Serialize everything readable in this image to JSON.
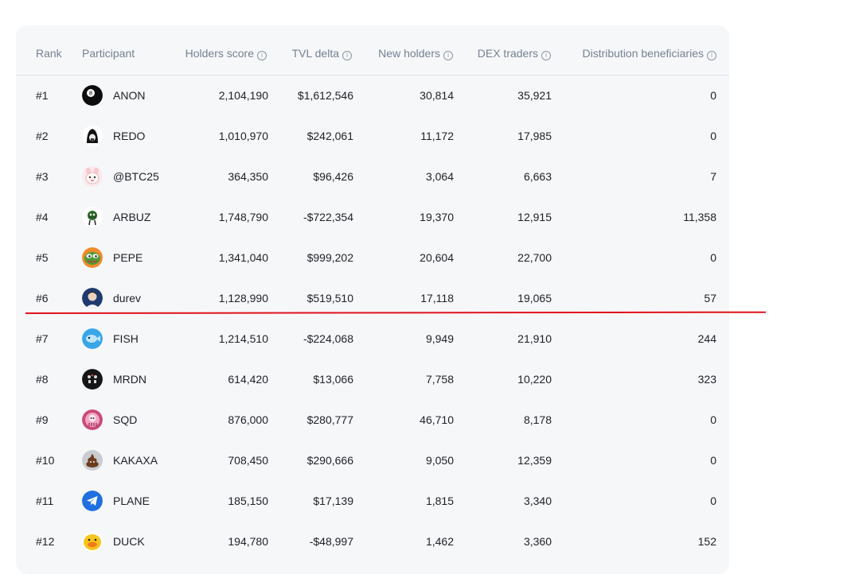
{
  "columns": {
    "rank": "Rank",
    "participant": "Participant",
    "holders_score": "Holders score",
    "tvl_delta": "TVL delta",
    "new_holders": "New holders",
    "dex_traders": "DEX traders",
    "distribution": "Distribution beneficiaries",
    "info_glyph": "i"
  },
  "rows": [
    {
      "rank": "#1",
      "name": "ANON",
      "icon": "8-ball-icon",
      "holders_score": "2,104,190",
      "tvl_delta": "$1,612,546",
      "new_holders": "30,814",
      "dex_traders": "35,921",
      "distribution": "0"
    },
    {
      "rank": "#2",
      "name": "REDO",
      "icon": "hooded-figure-icon",
      "holders_score": "1,010,970",
      "tvl_delta": "$242,061",
      "new_holders": "11,172",
      "dex_traders": "17,985",
      "distribution": "0"
    },
    {
      "rank": "#3",
      "name": "@BTC25",
      "icon": "pink-bunny-icon",
      "holders_score": "364,350",
      "tvl_delta": "$96,426",
      "new_holders": "3,064",
      "dex_traders": "6,663",
      "distribution": "7"
    },
    {
      "rank": "#4",
      "name": "ARBUZ",
      "icon": "watermelon-creature-icon",
      "holders_score": "1,748,790",
      "tvl_delta": "-$722,354",
      "new_holders": "19,370",
      "dex_traders": "12,915",
      "distribution": "11,358"
    },
    {
      "rank": "#5",
      "name": "PEPE",
      "icon": "pepe-frog-icon",
      "holders_score": "1,341,040",
      "tvl_delta": "$999,202",
      "new_holders": "20,604",
      "dex_traders": "22,700",
      "distribution": "0"
    },
    {
      "rank": "#6",
      "name": "durev",
      "icon": "portrait-icon",
      "holders_score": "1,128,990",
      "tvl_delta": "$519,510",
      "new_holders": "17,118",
      "dex_traders": "19,065",
      "distribution": "57"
    },
    {
      "rank": "#7",
      "name": "FISH",
      "icon": "blue-fish-icon",
      "holders_score": "1,214,510",
      "tvl_delta": "-$224,068",
      "new_holders": "9,949",
      "dex_traders": "21,910",
      "distribution": "244"
    },
    {
      "rank": "#8",
      "name": "MRDN",
      "icon": "dark-emblem-icon",
      "holders_score": "614,420",
      "tvl_delta": "$13,066",
      "new_holders": "7,758",
      "dex_traders": "10,220",
      "distribution": "323"
    },
    {
      "rank": "#9",
      "name": "SQD",
      "icon": "pink-squid-icon",
      "holders_score": "876,000",
      "tvl_delta": "$280,777",
      "new_holders": "46,710",
      "dex_traders": "8,178",
      "distribution": "0"
    },
    {
      "rank": "#10",
      "name": "KAKAXA",
      "icon": "poop-icon",
      "holders_score": "708,450",
      "tvl_delta": "$290,666",
      "new_holders": "9,050",
      "dex_traders": "12,359",
      "distribution": "0"
    },
    {
      "rank": "#11",
      "name": "PLANE",
      "icon": "paper-plane-icon",
      "holders_score": "185,150",
      "tvl_delta": "$17,139",
      "new_holders": "1,815",
      "dex_traders": "3,340",
      "distribution": "0"
    },
    {
      "rank": "#12",
      "name": "DUCK",
      "icon": "duck-icon",
      "holders_score": "194,780",
      "tvl_delta": "-$48,997",
      "new_holders": "1,462",
      "dex_traders": "3,360",
      "distribution": "152"
    }
  ]
}
